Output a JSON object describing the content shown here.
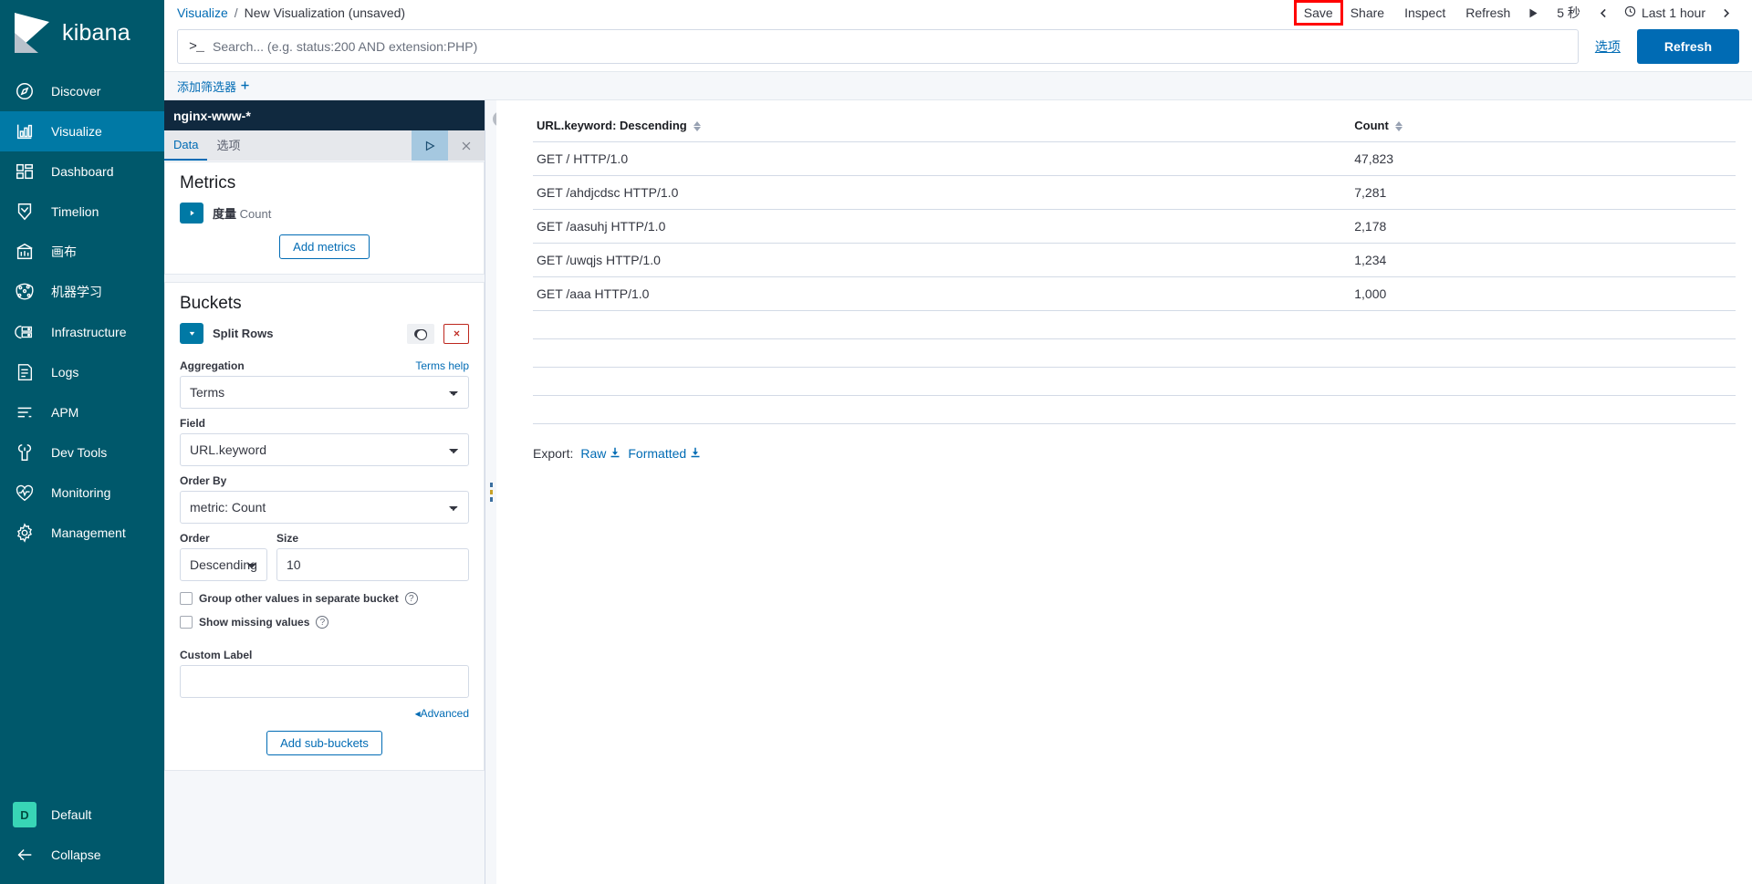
{
  "app": {
    "name": "kibana",
    "logo_icon": "kibana-logo"
  },
  "sidebar": {
    "items": [
      {
        "label": "Discover",
        "icon": "compass-icon",
        "active": false
      },
      {
        "label": "Visualize",
        "icon": "bar-chart-icon",
        "active": true
      },
      {
        "label": "Dashboard",
        "icon": "dashboard-icon",
        "active": false
      },
      {
        "label": "Timelion",
        "icon": "timelion-icon",
        "active": false
      },
      {
        "label": "画布",
        "icon": "canvas-icon",
        "active": false
      },
      {
        "label": "机器学习",
        "icon": "ml-icon",
        "active": false
      },
      {
        "label": "Infrastructure",
        "icon": "infra-icon",
        "active": false
      },
      {
        "label": "Logs",
        "icon": "logs-icon",
        "active": false
      },
      {
        "label": "APM",
        "icon": "apm-icon",
        "active": false
      },
      {
        "label": "Dev Tools",
        "icon": "wrench-icon",
        "active": false
      },
      {
        "label": "Monitoring",
        "icon": "heartbeat-icon",
        "active": false
      },
      {
        "label": "Management",
        "icon": "gear-icon",
        "active": false
      }
    ],
    "space": {
      "badge": "D",
      "label": "Default"
    },
    "collapse": {
      "label": "Collapse",
      "icon": "arrow-left-icon"
    }
  },
  "breadcrumb": {
    "parent": "Visualize",
    "separator": "/",
    "current": "New Visualization (unsaved)"
  },
  "topnav": {
    "save": "Save",
    "share": "Share",
    "inspect": "Inspect",
    "refresh": "Refresh",
    "play_icon": "play-icon",
    "interval": "5 秒",
    "prev_icon": "chevron-left-icon",
    "clock_icon": "clock-icon",
    "time_range": "Last 1 hour",
    "next_icon": "chevron-right-icon",
    "highlight_color": "#ff0000"
  },
  "query": {
    "prompt": ">_",
    "placeholder": "Search... (e.g. status:200 AND extension:PHP)",
    "value": "",
    "options_label": "选项",
    "refresh_label": "Refresh"
  },
  "filters": {
    "add_label": "添加筛选器",
    "add_icon": "plus-icon"
  },
  "editor": {
    "index_pattern": "nginx-www-*",
    "tabs": [
      {
        "label": "Data",
        "active": true
      },
      {
        "label": "选项",
        "active": false
      }
    ],
    "apply_icon": "play-icon",
    "cancel_icon": "close-icon",
    "metrics": {
      "title": "Metrics",
      "expand_icon": "caret-right-icon",
      "agg_label": "度量",
      "agg_value": "Count",
      "add_label": "Add metrics"
    },
    "buckets": {
      "title": "Buckets",
      "expand_icon": "caret-down-icon",
      "bucket_type": "Split Rows",
      "toggle_icon": "toggle-icon",
      "remove_icon": "remove-x-icon",
      "aggregation_label": "Aggregation",
      "terms_help": "Terms help",
      "aggregation_value": "Terms",
      "field_label": "Field",
      "field_value": "URL.keyword",
      "order_by_label": "Order By",
      "order_by_value": "metric: Count",
      "order_label": "Order",
      "order_value": "Descending",
      "size_label": "Size",
      "size_value": "10",
      "group_other_label": "Group other values in separate bucket",
      "group_other_checked": false,
      "show_missing_label": "Show missing values",
      "show_missing_checked": false,
      "custom_label_label": "Custom Label",
      "custom_label_value": "",
      "advanced_label": "Advanced",
      "advanced_icon": "caret-left-icon",
      "add_sub_label": "Add sub-buckets"
    }
  },
  "vis": {
    "collapse_icon": "chevron-left-circle-icon",
    "resize_icon": "grip-icon",
    "export": {
      "label": "Export:",
      "raw_label": "Raw",
      "formatted_label": "Formatted",
      "download_icon": "download-icon"
    }
  },
  "chart_data": {
    "type": "table",
    "title": "",
    "columns": [
      "URL.keyword: Descending",
      "Count"
    ],
    "categories": [
      "GET / HTTP/1.0",
      "GET /ahdjcdsc HTTP/1.0",
      "GET /aasuhj HTTP/1.0",
      "GET /uwqjs HTTP/1.0",
      "GET /aaa HTTP/1.0"
    ],
    "values": [
      47823,
      7281,
      2178,
      1234,
      1000
    ],
    "value_labels": [
      "47,823",
      "7,281",
      "2,178",
      "1,234",
      "1,000"
    ],
    "rows": [
      {
        "key": "GET / HTTP/1.0",
        "count": "47,823"
      },
      {
        "key": "GET /ahdjcdsc HTTP/1.0",
        "count": "7,281"
      },
      {
        "key": "GET /aasuhj HTTP/1.0",
        "count": "2,178"
      },
      {
        "key": "GET /uwqjs HTTP/1.0",
        "count": "1,234"
      },
      {
        "key": "GET /aaa HTTP/1.0",
        "count": "1,000"
      }
    ],
    "empty_rows": 4,
    "sort_column": "URL.keyword",
    "sort_direction": "Descending",
    "xlabel": "URL.keyword",
    "ylabel": "Count"
  }
}
